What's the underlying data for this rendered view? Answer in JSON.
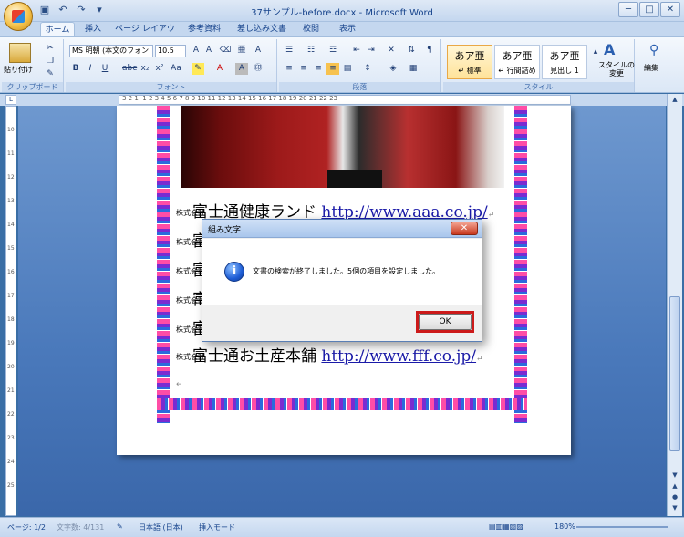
{
  "window": {
    "title": "37サンプル-before.docx - Microsoft Word",
    "min": "─",
    "max": "□",
    "close": "✕"
  },
  "qat": {
    "save": "▣",
    "undo": "↶",
    "redo": "↷",
    "more": "▾"
  },
  "tabs": [
    "ホーム",
    "挿入",
    "ページ レイアウト",
    "参考資料",
    "差し込み文書",
    "校閲",
    "表示"
  ],
  "ribbon": {
    "clipboard": {
      "label": "クリップボード",
      "paste": "貼り付け"
    },
    "font": {
      "label": "フォント",
      "name": "MS 明朝 (本文のフォン",
      "size": "10.5"
    },
    "paragraph": {
      "label": "段落"
    },
    "styles": {
      "label": "スタイル",
      "items": [
        {
          "sample": "あア亜",
          "name": "↵ 標準"
        },
        {
          "sample": "あア亜",
          "name": "↵ 行間詰め"
        },
        {
          "sample": "あア亜",
          "name": "見出し 1"
        }
      ],
      "change": "スタイルの変更"
    },
    "edit": {
      "label": "編集"
    }
  },
  "ruler": {
    "marks": "3 2 1  1 2 3 4 5 6 7 8 9 10 11 12 13 14 15 16 17 18 19 20 21 22 23"
  },
  "left_ruler": [
    "10",
    "11",
    "12",
    "13",
    "14",
    "15",
    "16",
    "17",
    "18",
    "19",
    "20",
    "21",
    "22",
    "23",
    "24",
    "25"
  ],
  "document": {
    "lines": [
      {
        "kk": "株式会社",
        "name": "富士通健康ランド",
        "url": "http://www.aaa.co.jp/"
      },
      {
        "kk": "株式会社",
        "name": "富",
        "url": ""
      },
      {
        "kk": "株式会社",
        "name": "富",
        "url": ""
      },
      {
        "kk": "株式会社",
        "name": "富",
        "url": ""
      },
      {
        "kk": "株式会社",
        "name": "富",
        "url": ""
      },
      {
        "kk": "株式会社",
        "name": "富士通お土産本舗",
        "url": "http://www.fff.co.jp/"
      }
    ],
    "pmark": "↵"
  },
  "dialog": {
    "title": "組み文字",
    "message": "文書の検索が終了しました。5個の項目を設定しました。",
    "ok": "OK",
    "close": "✕",
    "icon": "i"
  },
  "status": {
    "page": "ページ: 1/2",
    "chars": "文字数: 4/131",
    "lang": "日本語 (日本)",
    "mode": "挿入モード",
    "zoom": "180%"
  }
}
